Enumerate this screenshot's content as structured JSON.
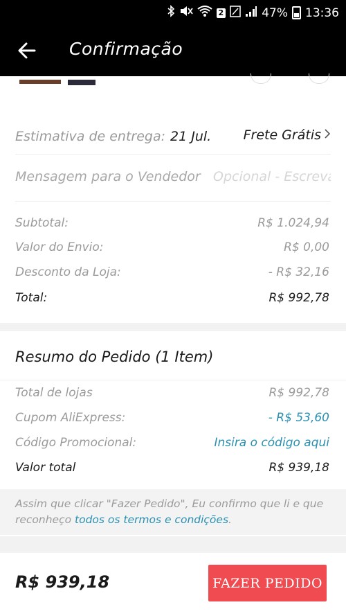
{
  "status_bar": {
    "battery": "47%",
    "time": "13:36",
    "sim_badge": "2"
  },
  "app_bar": {
    "title": "Confirmação",
    "back_icon": "arrow-left-icon"
  },
  "delivery": {
    "estimate_label": "Estimativa de entrega:",
    "estimate_date": "21 Jul.",
    "shipping_option": "Frete Grátis",
    "chevron_icon": "chevron-right-icon"
  },
  "seller_message": {
    "label": "Mensagem para o Vendedor",
    "placeholder": "Opcional - Escreva"
  },
  "store_summary": {
    "subtotal_label": "Subtotal:",
    "subtotal_value": "R$ 1.024,94",
    "shipping_label": "Valor do Envio:",
    "shipping_value": "R$ 0,00",
    "discount_label": "Desconto da Loja:",
    "discount_value": "- R$ 32,16",
    "total_label": "Total:",
    "total_value": "R$ 992,78"
  },
  "order_summary": {
    "title": "Resumo do Pedido (1 Item)",
    "stores_total_label": "Total de lojas",
    "stores_total_value": "R$ 992,78",
    "coupon_label": "Cupom AliExpress:",
    "coupon_value": "- R$ 53,60",
    "promo_label": "Código Promocional:",
    "promo_value": "Insira o código aqui",
    "grand_total_label": "Valor total",
    "grand_total_value": "R$ 939,18"
  },
  "notice": {
    "text_before": "Assim que clicar \"Fazer Pedido\", Eu confirmo que li e que reconheço ",
    "link_text": "todos os termos e condições",
    "text_after": "."
  },
  "bottom_bar": {
    "total": "R$ 939,18",
    "button_label": "FAZER PEDIDO"
  },
  "colors": {
    "accent": "#f04b50",
    "link": "#2a8fb0",
    "app_bar": "#000000"
  }
}
